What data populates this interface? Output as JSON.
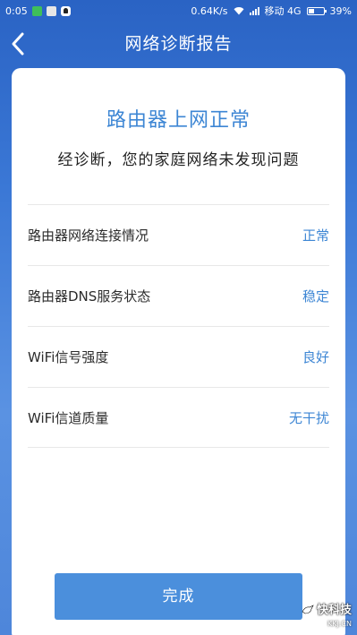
{
  "status_bar": {
    "time": "0:05",
    "network_speed": "0.64K/s",
    "carrier": "移动 4G",
    "battery": "39%",
    "battery_level": 0.39
  },
  "header": {
    "title": "网络诊断报告"
  },
  "result": {
    "headline": "路由器上网正常",
    "summary": "经诊断，您的家庭网络未发现问题"
  },
  "checks": [
    {
      "label": "路由器网络连接情况",
      "status": "正常"
    },
    {
      "label": "路由器DNS服务状态",
      "status": "稳定"
    },
    {
      "label": "WiFi信号强度",
      "status": "良好"
    },
    {
      "label": "WiFi信道质量",
      "status": "无干扰"
    }
  ],
  "actions": {
    "done_label": "完成"
  },
  "watermark": {
    "name": "快科技",
    "domain": "KKJ.CN"
  },
  "colors": {
    "accent": "#3d86d4",
    "button": "#4b8fdc",
    "background_top": "#2a63c4",
    "background_bottom": "#5a92e2"
  }
}
